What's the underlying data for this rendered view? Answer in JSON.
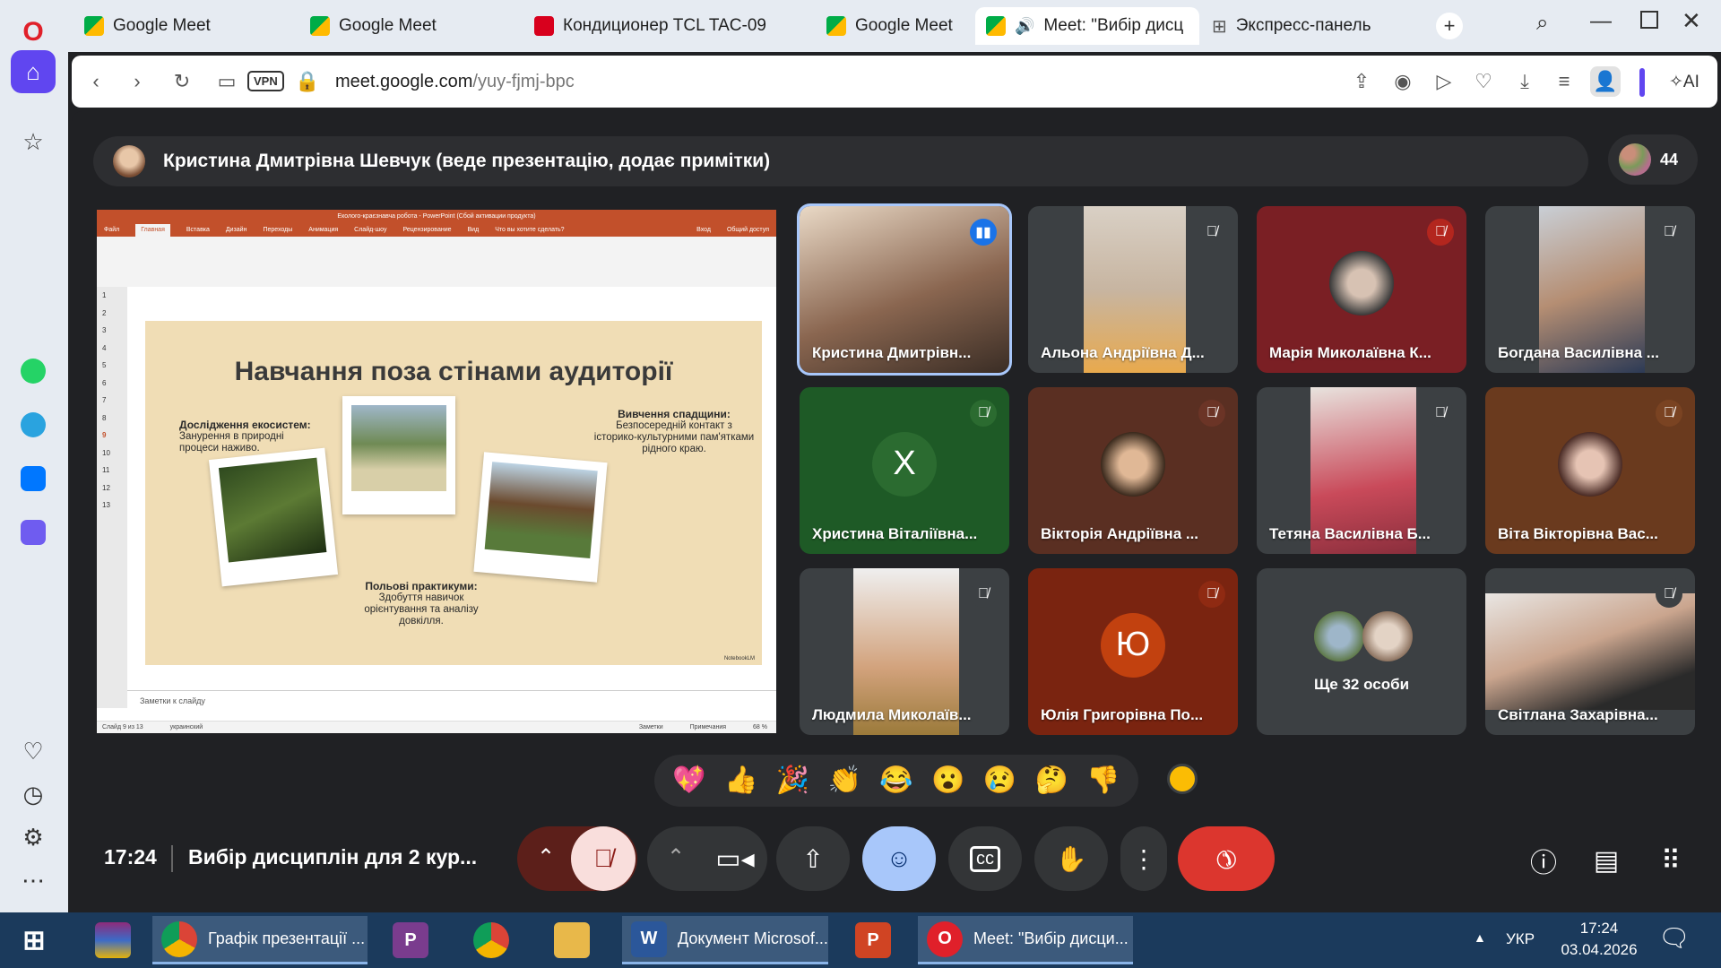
{
  "browser": {
    "tabs": [
      {
        "label": "Google Meet",
        "active": false
      },
      {
        "label": "Google Meet",
        "active": false
      },
      {
        "label": "Кондиционер TCL TAC-09",
        "active": false
      },
      {
        "label": "Google Meet",
        "active": false
      },
      {
        "label": "Meet: \"Вибір дисц",
        "active": true
      },
      {
        "label": "Экспресс-панель",
        "active": false
      }
    ],
    "new_tab": "+",
    "url_domain": "meet.google.com",
    "url_path": "/yuy-fjmj-bpc",
    "vpn_label": "VPN",
    "ai_label": "AI",
    "sidebar_icons": [
      "home-icon",
      "star-icon",
      "whatsapp-icon",
      "telegram-icon",
      "vk-icon",
      "music-player-icon",
      "heart-icon",
      "history-icon",
      "settings-icon",
      "more-icon"
    ]
  },
  "meet": {
    "presenter_label": "Кристина Дмитрівна Шевчук (веде презентацію, додає примітки)",
    "participant_count": "44",
    "slide": {
      "window_title": "Еколого-краєзнавча робота - PowerPoint (Сбой активации продукта)",
      "ribbon_tabs": [
        "Файл",
        "Главная",
        "Вставка",
        "Дизайн",
        "Переходы",
        "Анимация",
        "Слайд-шоу",
        "Рецензирование",
        "Вид",
        "Что вы хотите сделать?",
        "Вход",
        "Общий доступ"
      ],
      "thumbs": [
        "1",
        "2",
        "3",
        "4",
        "5",
        "6",
        "7",
        "8",
        "9",
        "10",
        "11",
        "12",
        "13"
      ],
      "title": "Навчання поза стінами аудиторії",
      "block1_head": "Дослідження екосистем:",
      "block1_body": "Занурення в природні процеси наживо.",
      "block2_head": "Вивчення спадщини:",
      "block2_body": "Безпосередній контакт з історико-культурними пам'ятками рідного краю.",
      "block3_head": "Польові практикуми:",
      "block3_body": "Здобуття навичок орієнтування та аналізу довкілля.",
      "watermark": "NotebookLM",
      "notes_placeholder": "Заметки к слайду",
      "status_slide": "Слайд 9 из 13",
      "status_lang": "украинский",
      "status_notes": "Заметки",
      "status_comments": "Примечания",
      "status_zoom": "68 %"
    },
    "tiles": [
      {
        "name": "Кристина Дмитрівн...",
        "type": "video",
        "muted": false
      },
      {
        "name": "Альона Андріївна Д...",
        "type": "video",
        "muted": true
      },
      {
        "name": "Марія Миколаївна К...",
        "type": "avatar",
        "muted": true
      },
      {
        "name": "Богдана Василівна ...",
        "type": "video",
        "muted": true
      },
      {
        "name": "Христина Віталіївна...",
        "type": "letter",
        "letter": "Х",
        "muted": true
      },
      {
        "name": "Вікторія Андріївна ...",
        "type": "avatar",
        "muted": true
      },
      {
        "name": "Тетяна Василівна Б...",
        "type": "video",
        "muted": true
      },
      {
        "name": "Віта Вікторівна Вас...",
        "type": "avatar",
        "muted": true
      },
      {
        "name": "Людмила Миколаїв...",
        "type": "video",
        "muted": true
      },
      {
        "name": "Юлія Григорівна По...",
        "type": "letter",
        "letter": "Ю",
        "muted": true
      },
      {
        "name": "Ще 32 особи",
        "type": "more",
        "muted": false
      },
      {
        "name": "Світлана Захарівна...",
        "type": "video",
        "muted": true
      }
    ],
    "reactions": [
      "💖",
      "👍",
      "🎉",
      "👏",
      "😂",
      "😮",
      "😢",
      "🤔",
      "👎"
    ],
    "time": "17:24",
    "meeting_title": "Вибір дисциплін для 2 кур..."
  },
  "taskbar": {
    "apps": [
      {
        "label": "Графік презентації ..."
      },
      {
        "label": "Документ Microsof..."
      },
      {
        "label": "Meet: \"Вибір дисци..."
      }
    ],
    "lang": "УКР",
    "clock_time": "17:24",
    "clock_date": "03.04.2026"
  }
}
